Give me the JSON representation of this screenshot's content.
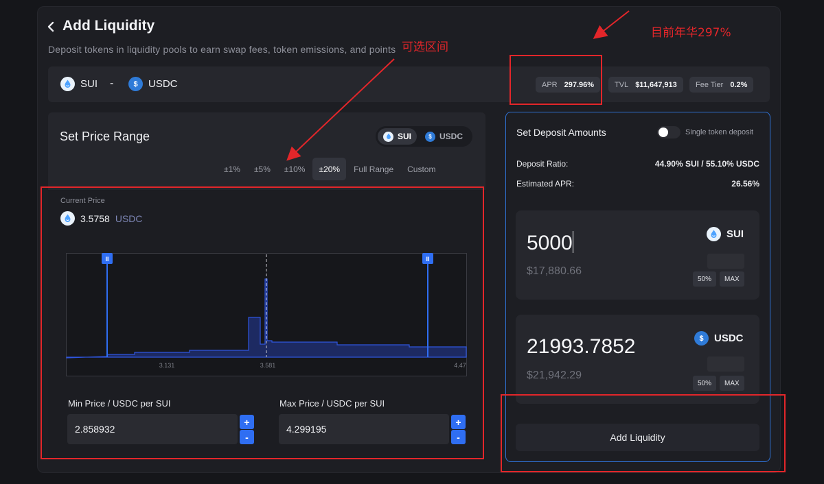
{
  "header": {
    "back_icon": "chevron-left-icon",
    "title": "Add Liquidity",
    "subtitle": "Deposit tokens in liquidity pools to earn swap fees, token emissions, and points"
  },
  "pool": {
    "token_a": "SUI",
    "separator": "-",
    "token_b": "USDC",
    "apr_label": "APR",
    "apr_value": "297.96%",
    "tvl_label": "TVL",
    "tvl_value": "$11,647,913",
    "fee_label": "Fee Tier",
    "fee_value": "0.2%"
  },
  "range": {
    "title": "Set Price Range",
    "toggle": [
      "SUI",
      "USDC"
    ],
    "toggle_active": "SUI",
    "options": [
      "±1%",
      "±5%",
      "±10%",
      "±20%",
      "Full Range",
      "Custom"
    ],
    "active_option": "±20%",
    "current_price_label": "Current Price",
    "current_price": "3.5758",
    "current_unit": "USDC",
    "min_label": "Min Price / USDC per SUI",
    "min_value": "2.858932",
    "max_label": "Max Price / USDC per SUI",
    "max_value": "4.299195",
    "plus": "+",
    "minus": "-"
  },
  "chart_data": {
    "type": "area",
    "x_ticks": [
      "3.131",
      "3.581",
      "4.47"
    ],
    "current_price": 3.581,
    "min_handle": 2.858932,
    "max_handle": 4.299195,
    "handle_label": "II"
  },
  "deposit": {
    "title": "Set Deposit Amounts",
    "single_token_label": "Single token deposit",
    "single_token_on": false,
    "ratio_label": "Deposit Ratio:",
    "ratio_value": "44.90% SUI / 55.10% USDC",
    "est_apr_label": "Estimated APR:",
    "est_apr_value": "26.56%",
    "sui_amount": "5000",
    "sui_usd": "$17,880.66",
    "sui_token": "SUI",
    "usdc_amount": "21993.7852",
    "usdc_usd": "$21,942.29",
    "usdc_token": "USDC",
    "half_label": "50%",
    "max_label": "MAX",
    "submit_label": "Add Liquidity"
  },
  "annotations": {
    "apr_note": "目前年华297%",
    "range_note": "可选区间",
    "color": "#e3262a"
  },
  "colors": {
    "accent": "#2f6ef2",
    "usdc": "#2f7bd8",
    "annotation": "#e3262a"
  }
}
